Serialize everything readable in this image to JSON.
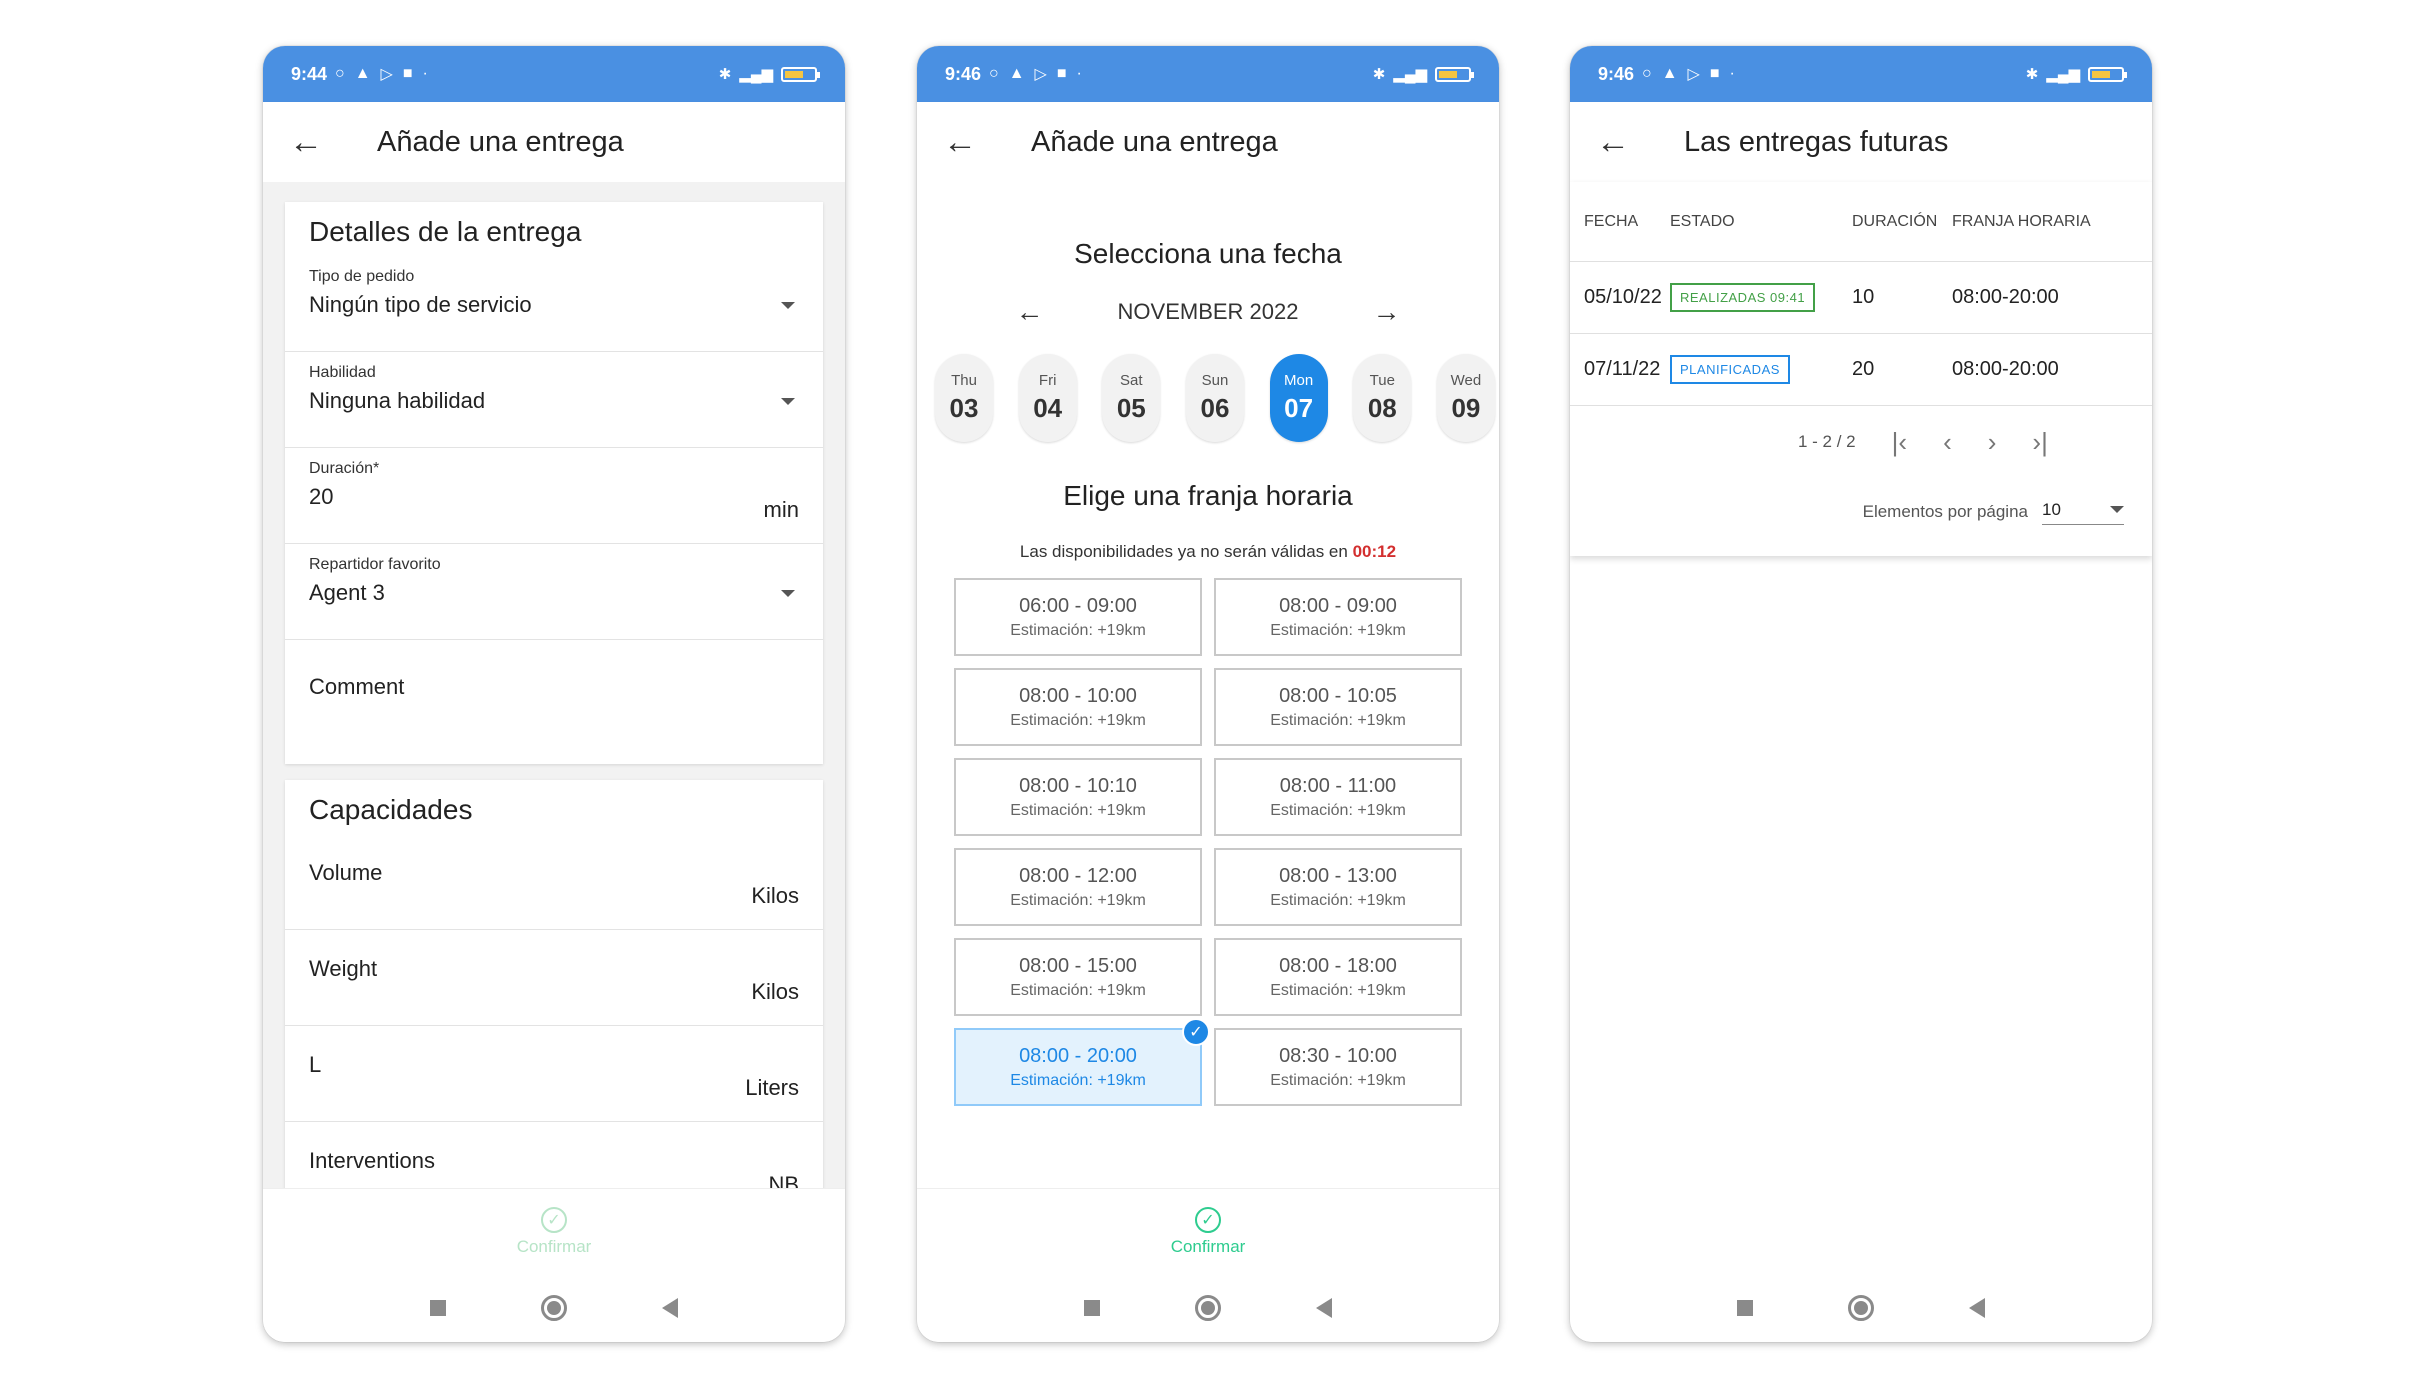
{
  "phone1": {
    "status": {
      "time": "9:44"
    },
    "appbar": {
      "title": "Añade una entrega"
    },
    "details_card": {
      "title": "Detalles de la entrega",
      "order_type": {
        "label": "Tipo de pedido",
        "value": "Ningún tipo de servicio"
      },
      "skill": {
        "label": "Habilidad",
        "value": "Ninguna habilidad"
      },
      "duration": {
        "label": "Duración*",
        "value": "20",
        "unit": "min"
      },
      "agent": {
        "label": "Repartidor favorito",
        "value": "Agent 3"
      },
      "comment": {
        "placeholder": "Comment"
      }
    },
    "capacities_card": {
      "title": "Capacidades",
      "rows": [
        {
          "label": "Volume",
          "unit": "Kilos"
        },
        {
          "label": "Weight",
          "unit": "Kilos"
        },
        {
          "label": "L",
          "unit": "Liters"
        },
        {
          "label": "Interventions",
          "unit": "NB"
        }
      ]
    },
    "confirm": {
      "label": "Confirmar",
      "color": "#b7e4c7"
    }
  },
  "phone2": {
    "status": {
      "time": "9:46"
    },
    "appbar": {
      "title": "Añade una entrega"
    },
    "date_heading": "Selecciona una fecha",
    "month": "NOVEMBER 2022",
    "days": [
      {
        "name": "Thu",
        "num": "03"
      },
      {
        "name": "Fri",
        "num": "04"
      },
      {
        "name": "Sat",
        "num": "05"
      },
      {
        "name": "Sun",
        "num": "06"
      },
      {
        "name": "Mon",
        "num": "07",
        "selected": true
      },
      {
        "name": "Tue",
        "num": "08"
      },
      {
        "name": "Wed",
        "num": "09"
      }
    ],
    "slot_heading": "Elige una franja horaria",
    "expiry_text": "Las disponibilidades ya no serán válidas en",
    "expiry_time": "00:12",
    "slots": [
      {
        "range": "06:00 - 09:00",
        "est": "Estimación: +19km"
      },
      {
        "range": "08:00 - 09:00",
        "est": "Estimación: +19km"
      },
      {
        "range": "08:00 - 10:00",
        "est": "Estimación: +19km"
      },
      {
        "range": "08:00 - 10:05",
        "est": "Estimación: +19km"
      },
      {
        "range": "08:00 - 10:10",
        "est": "Estimación: +19km"
      },
      {
        "range": "08:00 - 11:00",
        "est": "Estimación: +19km"
      },
      {
        "range": "08:00 - 12:00",
        "est": "Estimación: +19km"
      },
      {
        "range": "08:00 - 13:00",
        "est": "Estimación: +19km"
      },
      {
        "range": "08:00 - 15:00",
        "est": "Estimación: +19km"
      },
      {
        "range": "08:00 - 18:00",
        "est": "Estimación: +19km"
      },
      {
        "range": "08:00 - 20:00",
        "est": "Estimación: +19km",
        "selected": true
      },
      {
        "range": "08:30 - 10:00",
        "est": "Estimación: +19km"
      }
    ],
    "confirm": {
      "label": "Confirmar",
      "color": "#2ecc8f"
    }
  },
  "phone3": {
    "status": {
      "time": "9:46"
    },
    "appbar": {
      "title": "Las entregas futuras"
    },
    "table": {
      "headers": [
        "FECHA",
        "ESTADO",
        "DURACIÓN",
        "FRANJA HORARIA"
      ],
      "rows": [
        {
          "date": "05/10/22",
          "status": "REALIZADAS 09:41",
          "status_type": "done",
          "duration": "10",
          "slot": "08:00-20:00"
        },
        {
          "date": "07/11/22",
          "status": "PLANIFICADAS",
          "status_type": "plan",
          "duration": "20",
          "slot": "08:00-20:00"
        }
      ]
    },
    "pager": {
      "range": "1 - 2 / 2"
    },
    "per_page": {
      "label": "Elementos por página",
      "value": "10"
    }
  },
  "colors": {
    "status_bar": "#4a90e2",
    "accent_blue": "#1e88e5",
    "done_green": "#43a047",
    "expiry_red": "#d32f2f"
  },
  "icons": {
    "back": "arrow-left-icon",
    "caret": "chevron-down-icon",
    "confirm": "check-circle-icon",
    "nav": [
      "square-icon",
      "home-circle-icon",
      "back-triangle-icon"
    ]
  }
}
